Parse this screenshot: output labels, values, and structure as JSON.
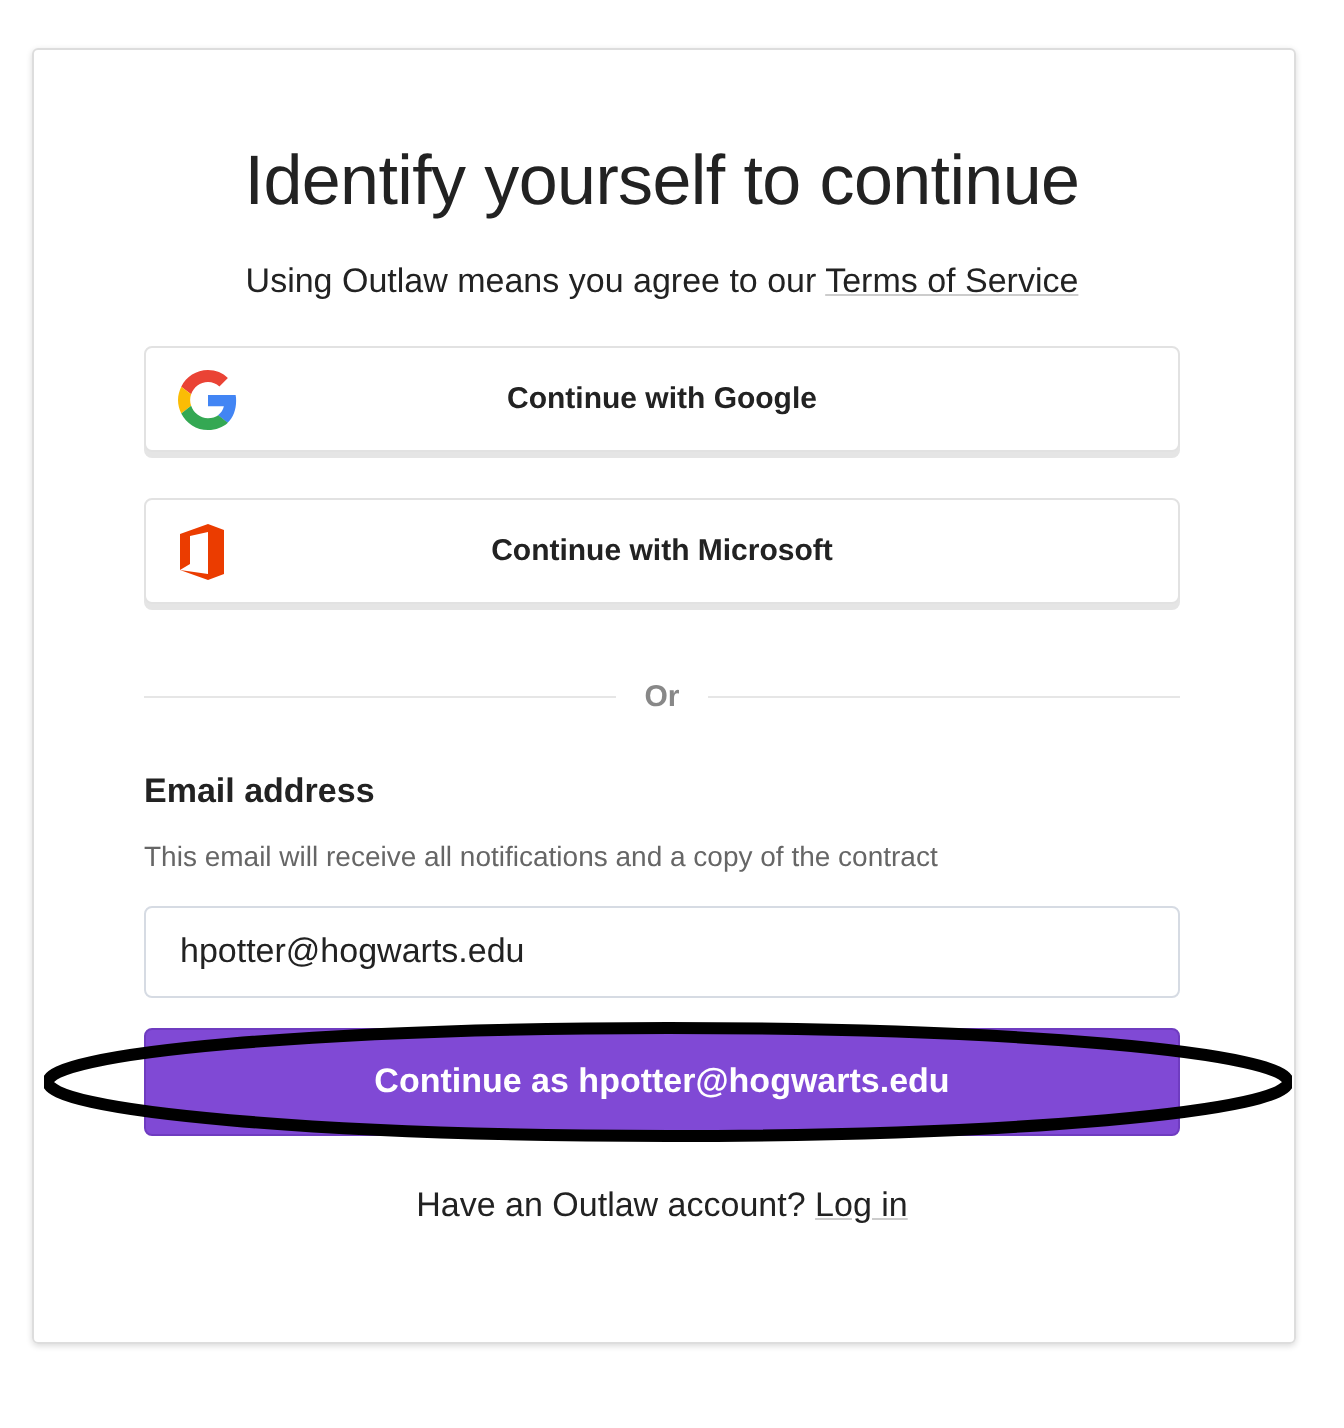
{
  "title": "Identify yourself to continue",
  "terms": {
    "text": "Using Outlaw means you agree to our",
    "link": "Terms of Service"
  },
  "providers": [
    {
      "kind": "google",
      "label": "Continue with Google"
    },
    {
      "kind": "microsoft",
      "label": "Continue with Microsoft"
    }
  ],
  "divider": "Or",
  "email": {
    "label": "Email address",
    "hint": "This email will receive all notifications and a copy of the contract",
    "value": "hpotter@hogwarts.edu"
  },
  "submit": {
    "label": "Continue as hpotter@hogwarts.edu",
    "circled": true
  },
  "footer": {
    "text": "Have an Outlaw account?",
    "link": "Log in"
  }
}
